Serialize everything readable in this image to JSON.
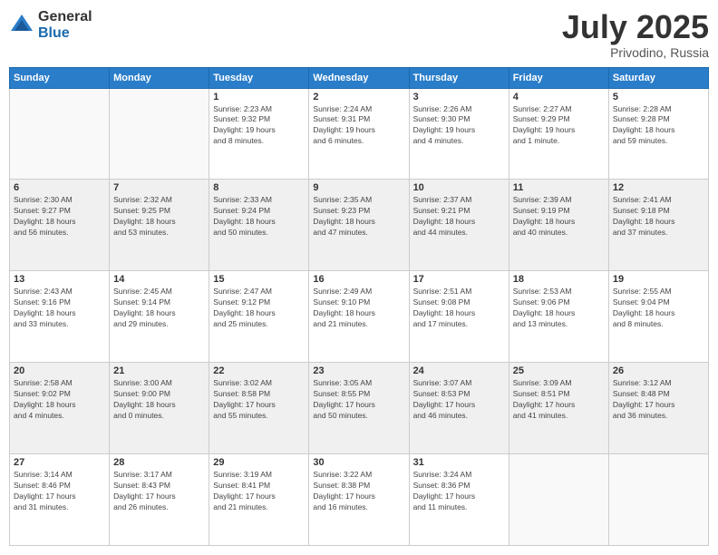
{
  "logo": {
    "general": "General",
    "blue": "Blue"
  },
  "title": "July 2025",
  "location": "Privodino, Russia",
  "days_header": [
    "Sunday",
    "Monday",
    "Tuesday",
    "Wednesday",
    "Thursday",
    "Friday",
    "Saturday"
  ],
  "weeks": [
    [
      {
        "day": "",
        "info": ""
      },
      {
        "day": "",
        "info": ""
      },
      {
        "day": "1",
        "info": "Sunrise: 2:23 AM\nSunset: 9:32 PM\nDaylight: 19 hours\nand 8 minutes."
      },
      {
        "day": "2",
        "info": "Sunrise: 2:24 AM\nSunset: 9:31 PM\nDaylight: 19 hours\nand 6 minutes."
      },
      {
        "day": "3",
        "info": "Sunrise: 2:26 AM\nSunset: 9:30 PM\nDaylight: 19 hours\nand 4 minutes."
      },
      {
        "day": "4",
        "info": "Sunrise: 2:27 AM\nSunset: 9:29 PM\nDaylight: 19 hours\nand 1 minute."
      },
      {
        "day": "5",
        "info": "Sunrise: 2:28 AM\nSunset: 9:28 PM\nDaylight: 18 hours\nand 59 minutes."
      }
    ],
    [
      {
        "day": "6",
        "info": "Sunrise: 2:30 AM\nSunset: 9:27 PM\nDaylight: 18 hours\nand 56 minutes."
      },
      {
        "day": "7",
        "info": "Sunrise: 2:32 AM\nSunset: 9:25 PM\nDaylight: 18 hours\nand 53 minutes."
      },
      {
        "day": "8",
        "info": "Sunrise: 2:33 AM\nSunset: 9:24 PM\nDaylight: 18 hours\nand 50 minutes."
      },
      {
        "day": "9",
        "info": "Sunrise: 2:35 AM\nSunset: 9:23 PM\nDaylight: 18 hours\nand 47 minutes."
      },
      {
        "day": "10",
        "info": "Sunrise: 2:37 AM\nSunset: 9:21 PM\nDaylight: 18 hours\nand 44 minutes."
      },
      {
        "day": "11",
        "info": "Sunrise: 2:39 AM\nSunset: 9:19 PM\nDaylight: 18 hours\nand 40 minutes."
      },
      {
        "day": "12",
        "info": "Sunrise: 2:41 AM\nSunset: 9:18 PM\nDaylight: 18 hours\nand 37 minutes."
      }
    ],
    [
      {
        "day": "13",
        "info": "Sunrise: 2:43 AM\nSunset: 9:16 PM\nDaylight: 18 hours\nand 33 minutes."
      },
      {
        "day": "14",
        "info": "Sunrise: 2:45 AM\nSunset: 9:14 PM\nDaylight: 18 hours\nand 29 minutes."
      },
      {
        "day": "15",
        "info": "Sunrise: 2:47 AM\nSunset: 9:12 PM\nDaylight: 18 hours\nand 25 minutes."
      },
      {
        "day": "16",
        "info": "Sunrise: 2:49 AM\nSunset: 9:10 PM\nDaylight: 18 hours\nand 21 minutes."
      },
      {
        "day": "17",
        "info": "Sunrise: 2:51 AM\nSunset: 9:08 PM\nDaylight: 18 hours\nand 17 minutes."
      },
      {
        "day": "18",
        "info": "Sunrise: 2:53 AM\nSunset: 9:06 PM\nDaylight: 18 hours\nand 13 minutes."
      },
      {
        "day": "19",
        "info": "Sunrise: 2:55 AM\nSunset: 9:04 PM\nDaylight: 18 hours\nand 8 minutes."
      }
    ],
    [
      {
        "day": "20",
        "info": "Sunrise: 2:58 AM\nSunset: 9:02 PM\nDaylight: 18 hours\nand 4 minutes."
      },
      {
        "day": "21",
        "info": "Sunrise: 3:00 AM\nSunset: 9:00 PM\nDaylight: 18 hours\nand 0 minutes."
      },
      {
        "day": "22",
        "info": "Sunrise: 3:02 AM\nSunset: 8:58 PM\nDaylight: 17 hours\nand 55 minutes."
      },
      {
        "day": "23",
        "info": "Sunrise: 3:05 AM\nSunset: 8:55 PM\nDaylight: 17 hours\nand 50 minutes."
      },
      {
        "day": "24",
        "info": "Sunrise: 3:07 AM\nSunset: 8:53 PM\nDaylight: 17 hours\nand 46 minutes."
      },
      {
        "day": "25",
        "info": "Sunrise: 3:09 AM\nSunset: 8:51 PM\nDaylight: 17 hours\nand 41 minutes."
      },
      {
        "day": "26",
        "info": "Sunrise: 3:12 AM\nSunset: 8:48 PM\nDaylight: 17 hours\nand 36 minutes."
      }
    ],
    [
      {
        "day": "27",
        "info": "Sunrise: 3:14 AM\nSunset: 8:46 PM\nDaylight: 17 hours\nand 31 minutes."
      },
      {
        "day": "28",
        "info": "Sunrise: 3:17 AM\nSunset: 8:43 PM\nDaylight: 17 hours\nand 26 minutes."
      },
      {
        "day": "29",
        "info": "Sunrise: 3:19 AM\nSunset: 8:41 PM\nDaylight: 17 hours\nand 21 minutes."
      },
      {
        "day": "30",
        "info": "Sunrise: 3:22 AM\nSunset: 8:38 PM\nDaylight: 17 hours\nand 16 minutes."
      },
      {
        "day": "31",
        "info": "Sunrise: 3:24 AM\nSunset: 8:36 PM\nDaylight: 17 hours\nand 11 minutes."
      },
      {
        "day": "",
        "info": ""
      },
      {
        "day": "",
        "info": ""
      }
    ]
  ]
}
